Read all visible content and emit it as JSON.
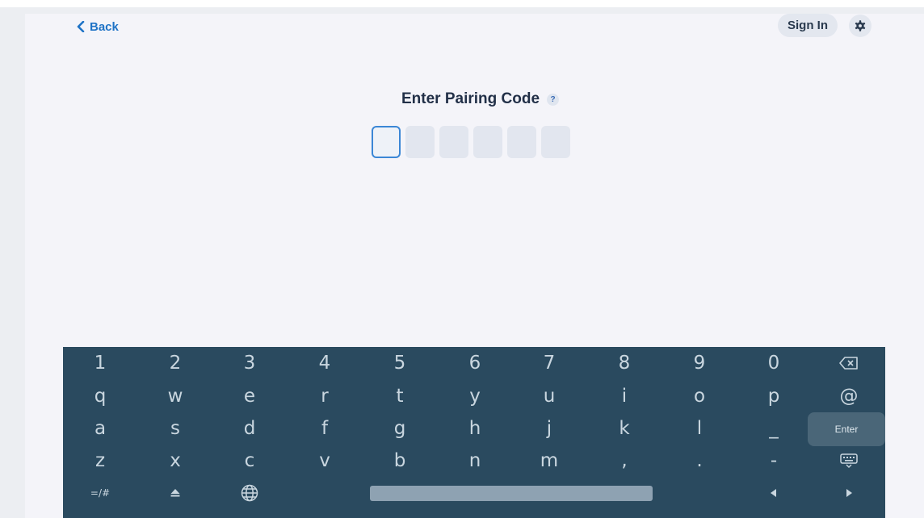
{
  "header": {
    "back_label": "Back",
    "signin_label": "Sign In",
    "settings_icon": "gear-icon"
  },
  "pairing": {
    "title": "Enter Pairing Code",
    "help_symbol": "?",
    "code_length": 6,
    "active_index": 0,
    "values": [
      "",
      "",
      "",
      "",
      "",
      ""
    ]
  },
  "keyboard": {
    "rows": [
      [
        "1",
        "2",
        "3",
        "4",
        "5",
        "6",
        "7",
        "8",
        "9",
        "0"
      ],
      [
        "q",
        "w",
        "e",
        "r",
        "t",
        "y",
        "u",
        "i",
        "o",
        "p",
        "@"
      ],
      [
        "a",
        "s",
        "d",
        "f",
        "g",
        "h",
        "j",
        "k",
        "l",
        "_"
      ],
      [
        "z",
        "x",
        "c",
        "v",
        "b",
        "n",
        "m",
        ",",
        ".",
        "-"
      ]
    ],
    "symbols_label": "=/#",
    "enter_label": "Enter",
    "backspace_icon": "backspace-icon",
    "keyboard_hide_icon": "keyboard-icon",
    "shift_icon": "shift-icon",
    "language_icon": "globe-icon",
    "left_arrow_icon": "arrow-left-icon",
    "right_arrow_icon": "arrow-right-icon"
  },
  "colors": {
    "accent": "#1f73c6",
    "keyboard_bg": "#2a4a5f",
    "key_text": "#c9d6df",
    "active_box_border": "#3b87d6"
  }
}
